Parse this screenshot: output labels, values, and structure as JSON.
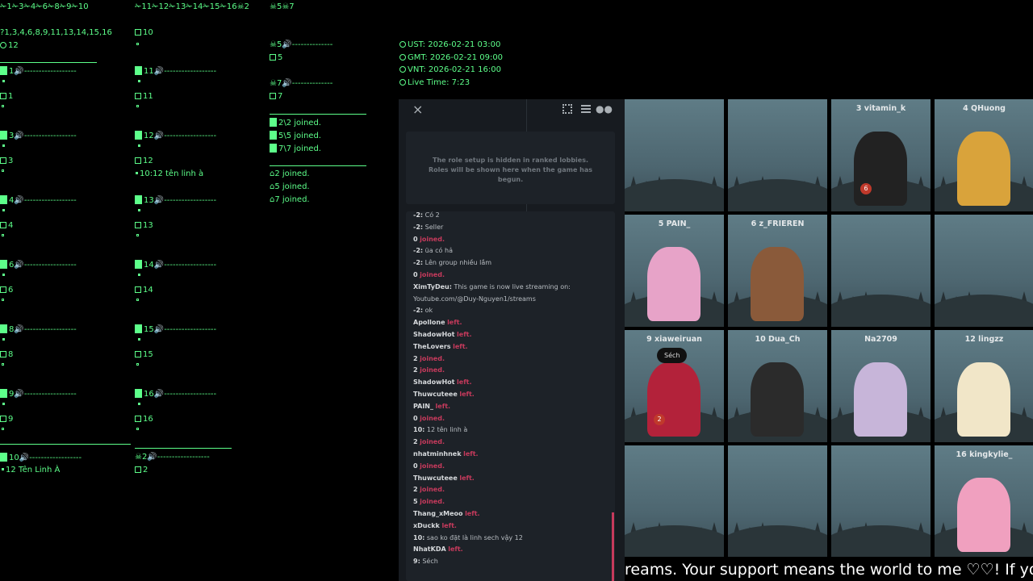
{
  "tracker": {
    "col1_header": "✁1✁3✁4✁6✁8✁9✁10",
    "col2_header": "✁11✁12✁13✁14✁15✁16☠2",
    "col3_header": "☠5☠7",
    "pins_line": "1,3,4,6,8,9,11,13,14,15,16",
    "clock_line": "12",
    "col1_slots": [
      {
        "speak": "1",
        "sub": "1"
      },
      {
        "speak": "3",
        "sub": "3"
      },
      {
        "speak": "4",
        "sub": "4"
      },
      {
        "speak": "6",
        "sub": "6"
      },
      {
        "speak": "8",
        "sub": "8"
      },
      {
        "speak": "9",
        "sub": "9"
      }
    ],
    "col1_last": {
      "speak": "10",
      "note": "12 Tên Linh À"
    },
    "col2_top": "10",
    "col2_slots": [
      {
        "speak": "11",
        "sub": "11",
        "note": ""
      },
      {
        "speak": "12",
        "sub": "12",
        "note": "10:12 tên linh à"
      },
      {
        "speak": "13",
        "sub": "13",
        "note": ""
      },
      {
        "speak": "14",
        "sub": "14",
        "note": ""
      },
      {
        "speak": "15",
        "sub": "15",
        "note": ""
      },
      {
        "speak": "16",
        "sub": "16",
        "note": ""
      }
    ],
    "col2_dead": {
      "speak": "2",
      "sub": "2"
    },
    "col3_dead": [
      {
        "speak": "5",
        "sub": "5"
      },
      {
        "speak": "7",
        "sub": "7"
      }
    ],
    "joined_box": [
      "2\\2 joined.",
      "5\\5 joined.",
      "7\\7 joined."
    ],
    "joined_list": [
      "2 joined.",
      "5 joined.",
      "7 joined."
    ],
    "dash": "------------------"
  },
  "clocks": [
    "UST: 2026-02-21 03:00",
    "GMT: 2026-02-21 09:00",
    "VNT: 2026-02-21 16:00",
    "Live Time: 7:23"
  ],
  "panel": {
    "close": "×",
    "role_notice": "The role setup is hidden in ranked lobbies. Roles will be shown here when the game has begun."
  },
  "chat": [
    {
      "who": "-2:",
      "text": "Có 2",
      "kind": "msg"
    },
    {
      "who": "-2:",
      "text": "Seller",
      "kind": "msg"
    },
    {
      "who": "0",
      "text": "joined.",
      "kind": "join"
    },
    {
      "who": "-2:",
      "text": "üa có hả",
      "kind": "msg"
    },
    {
      "who": "-2:",
      "text": "Lên group nhiều lắm",
      "kind": "msg"
    },
    {
      "who": "0",
      "text": "joined.",
      "kind": "join"
    },
    {
      "who": "XimTyDeu:",
      "text": "This game is now live streaming on:",
      "kind": "msg"
    },
    {
      "who": "",
      "text": "Youtube.com/@Duy-Nguyen1/streams",
      "kind": "msg"
    },
    {
      "who": "-2:",
      "text": "ok",
      "kind": "msg"
    },
    {
      "who": "Apollone",
      "text": "left.",
      "kind": "left"
    },
    {
      "who": "ShadowHot",
      "text": "left.",
      "kind": "left"
    },
    {
      "who": "TheLovers",
      "text": "left.",
      "kind": "left"
    },
    {
      "who": "2",
      "text": "joined.",
      "kind": "join"
    },
    {
      "who": "2",
      "text": "joined.",
      "kind": "join"
    },
    {
      "who": "ShadowHot",
      "text": "left.",
      "kind": "left"
    },
    {
      "who": "Thuwcuteee",
      "text": "left.",
      "kind": "left"
    },
    {
      "who": "PAIN_",
      "text": "left.",
      "kind": "left"
    },
    {
      "who": "0",
      "text": "joined.",
      "kind": "join"
    },
    {
      "who": "10:",
      "text": "12 tên linh à",
      "kind": "msg"
    },
    {
      "who": "2",
      "text": "joined.",
      "kind": "join"
    },
    {
      "who": "nhatminhnek",
      "text": "left.",
      "kind": "left"
    },
    {
      "who": "0",
      "text": "joined.",
      "kind": "join"
    },
    {
      "who": "Thuwcuteee",
      "text": "left.",
      "kind": "left"
    },
    {
      "who": "2",
      "text": "joined.",
      "kind": "join"
    },
    {
      "who": "5",
      "text": "joined.",
      "kind": "join"
    },
    {
      "who": "Thang_xMeoo",
      "text": "left.",
      "kind": "left"
    },
    {
      "who": "xDuckk",
      "text": "left.",
      "kind": "left"
    },
    {
      "who": "10:",
      "text": "sao ko đặt là linh sech vậy 12",
      "kind": "msg"
    },
    {
      "who": "NhatKDA",
      "text": "left.",
      "kind": "left"
    },
    {
      "who": "9:",
      "text": "Séch",
      "kind": "msg"
    }
  ],
  "players": [
    {
      "name": "",
      "avatar": ""
    },
    {
      "name": "",
      "avatar": ""
    },
    {
      "name": "3 vitamin_k",
      "avatar": "#222",
      "badge": "6"
    },
    {
      "name": "4 QHuong",
      "avatar": "#d9a33b"
    },
    {
      "name": "5 PAIN_",
      "avatar": "#e7a3c8"
    },
    {
      "name": "6 z_FRIEREN",
      "avatar": "#8a5a3a"
    },
    {
      "name": "",
      "avatar": ""
    },
    {
      "name": "",
      "avatar": ""
    },
    {
      "name": "9 xiaweiruan",
      "avatar": "#b3223a",
      "bubble": "Séch",
      "badge": "2"
    },
    {
      "name": "10 Dua_Ch",
      "avatar": "#2b2b2b"
    },
    {
      "name": "Na2709",
      "avatar": "#c7b5d9"
    },
    {
      "name": "12 lingzz",
      "avatar": "#f1e6c8"
    },
    {
      "name": "",
      "avatar": ""
    },
    {
      "name": "",
      "avatar": ""
    },
    {
      "name": "",
      "avatar": ""
    },
    {
      "name": "16 kingkylie_",
      "avatar": "#f0a0bf"
    }
  ],
  "ticker": "reams. Your support means the world to me ♡♡! If you'd li"
}
